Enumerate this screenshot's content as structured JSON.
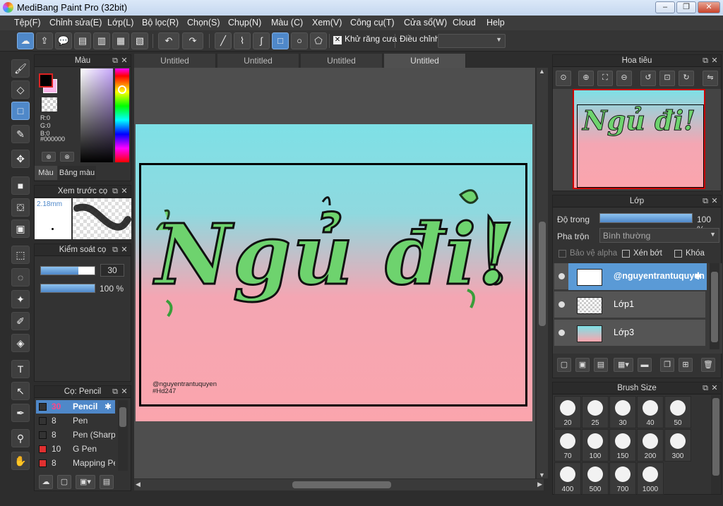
{
  "window": {
    "title": "MediBang Paint Pro (32bit)",
    "min": "‒",
    "max": "❐",
    "close": "✕"
  },
  "menu": [
    "Tệp(F)",
    "Chỉnh sửa(E)",
    "Lớp(L)",
    "Bộ lọc(R)",
    "Chọn(S)",
    "Chụp(N)",
    "Màu (C)",
    "Xem(V)",
    "Công cụ(T)",
    "Cửa sổ(W)",
    "Cloud",
    "Help"
  ],
  "toolbar": {
    "antialias_label": "Khử răng cưa",
    "adjust_label": "Điều chỉnh",
    "adjust_value": "",
    "antialias_checked": "✕"
  },
  "tabs": [
    "Untitled",
    "Untitled",
    "Untitled",
    "Untitled"
  ],
  "color_panel": {
    "title": "Màu",
    "r": "R:0",
    "g": "G:0",
    "b": "B:0",
    "hex": "#000000",
    "tab_color": "Màu",
    "tab_palette": "Bảng màu",
    "fg": "#000000",
    "bg": "#f8b6e8"
  },
  "preview_panel": {
    "title": "Xem trước cọ",
    "size": "2.18mm"
  },
  "brush_control": {
    "title": "Kiểm soát cọ",
    "size": "30",
    "opacity": "100 %",
    "size_fraction": 0.7,
    "opacity_fraction": 1.0
  },
  "brush_list": {
    "title": "Cọ: Pencil",
    "items": [
      {
        "size": "30",
        "name": "Pencil",
        "color": "#333333",
        "selected": true
      },
      {
        "size": "8",
        "name": "Pen",
        "color": "#333333"
      },
      {
        "size": "8",
        "name": "Pen (Sharp",
        "color": "#333333"
      },
      {
        "size": "10",
        "name": "G Pen",
        "color": "#e03030"
      },
      {
        "size": "8",
        "name": "Mapping Pe",
        "color": "#e03030"
      }
    ]
  },
  "artwork": {
    "main_text": "Ngủ đi!",
    "credit_line1": "@nguyentrantuquyen",
    "credit_line2": "#Hd247"
  },
  "navigator": {
    "title": "Hoa tiêu"
  },
  "layers": {
    "title": "Lớp",
    "opacity_label": "Độ trong",
    "opacity_value": "100 %",
    "opacity_fraction": 1.0,
    "blend_label": "Pha trộn",
    "blend_value": "Bình thường",
    "protect_alpha": "Bảo vệ alpha",
    "clipping": "Xén bớt",
    "lock": "Khóa",
    "items": [
      {
        "name": "@nguyentrantuquyen",
        "selected": true
      },
      {
        "name": "Lớp1"
      },
      {
        "name": "Lớp3"
      }
    ]
  },
  "brush_size": {
    "title": "Brush Size",
    "sizes": [
      "20",
      "25",
      "30",
      "40",
      "50",
      "70",
      "100",
      "150",
      "200",
      "300",
      "400",
      "500",
      "700",
      "1000"
    ]
  }
}
